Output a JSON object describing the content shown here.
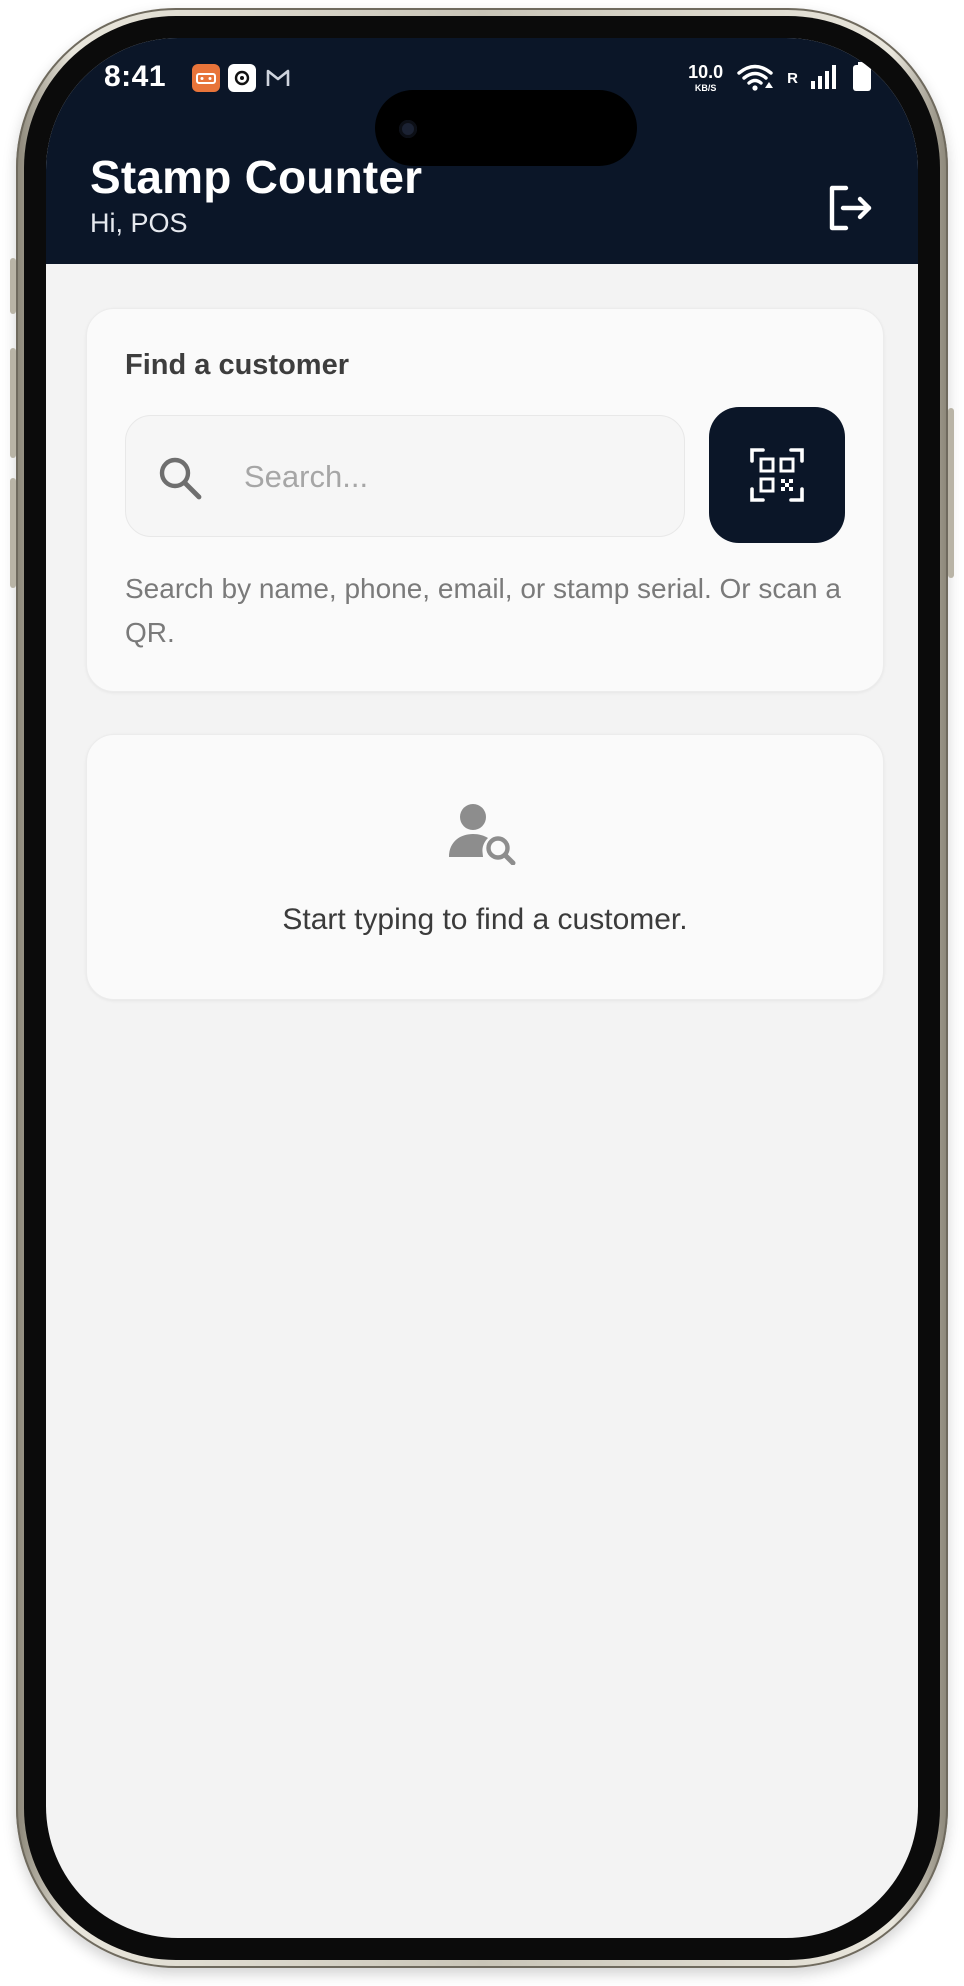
{
  "status_bar": {
    "time": "8:41",
    "net_speed_value": "10.0",
    "net_speed_unit": "KB/S",
    "carrier_flag": "R"
  },
  "header": {
    "title": "Stamp Counter",
    "subtitle": "Hi, POS",
    "background_color": "#0b1628"
  },
  "search_card": {
    "label": "Find a customer",
    "input_value": "",
    "input_placeholder": "Search...",
    "helper_text": "Search by name, phone, email, or stamp serial. Or scan a QR."
  },
  "empty_state": {
    "message": "Start typing to find a customer."
  },
  "icons": {
    "logout": "logout-icon",
    "search": "search-icon",
    "qr": "qr-scan-icon",
    "empty": "person-search-icon"
  }
}
